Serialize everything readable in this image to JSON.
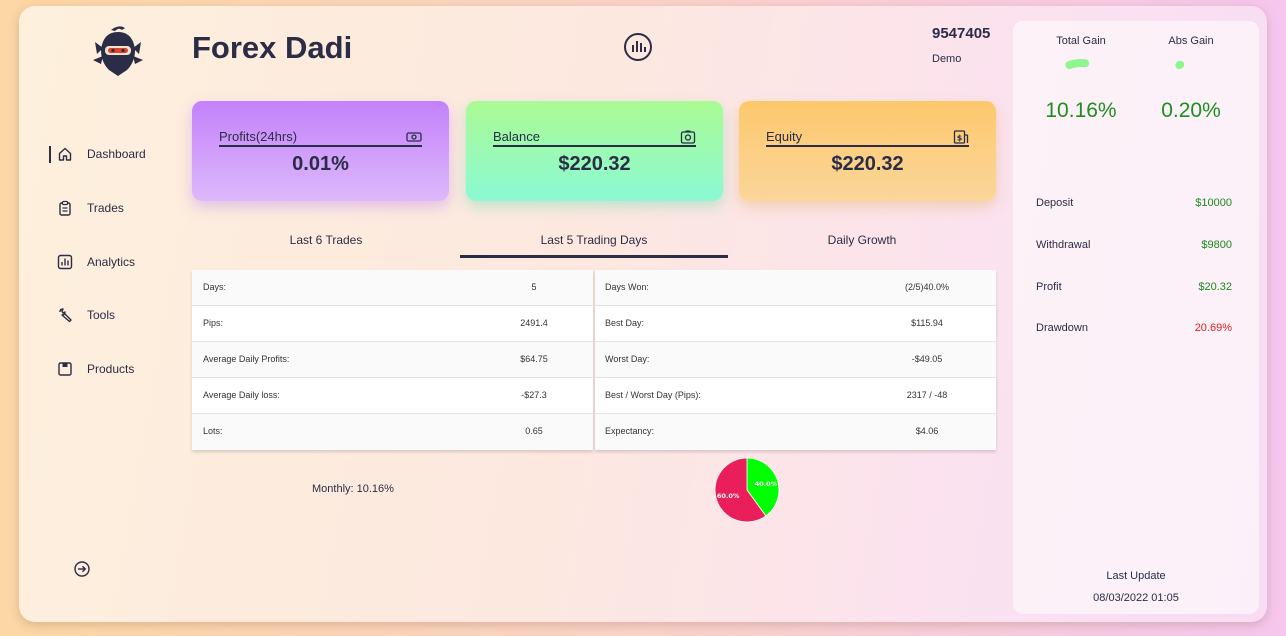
{
  "app": {
    "title": "Forex Dadi",
    "account_number": "9547405",
    "account_type": "Demo"
  },
  "sidebar": {
    "items": [
      {
        "label": "Dashboard",
        "icon": "home-icon",
        "active": true
      },
      {
        "label": "Trades",
        "icon": "clipboard-icon",
        "active": false
      },
      {
        "label": "Analytics",
        "icon": "bar-chart-icon",
        "active": false
      },
      {
        "label": "Tools",
        "icon": "tools-icon",
        "active": false
      },
      {
        "label": "Products",
        "icon": "box-icon",
        "active": false
      }
    ],
    "logout_icon": "logout-icon"
  },
  "cards": [
    {
      "label": "Profits(24hrs)",
      "value": "0.01%",
      "icon": "cash-icon"
    },
    {
      "label": "Balance",
      "value": "$220.32",
      "icon": "safe-icon"
    },
    {
      "label": "Equity",
      "value": "$220.32",
      "icon": "equity-icon"
    }
  ],
  "tabs": [
    {
      "label": "Last 6 Trades",
      "active": false
    },
    {
      "label": "Last 5 Trading Days",
      "active": true
    },
    {
      "label": "Daily Growth",
      "active": false
    }
  ],
  "table_left": [
    {
      "k": "Days:",
      "v": "5"
    },
    {
      "k": "Pips:",
      "v": "2491.4"
    },
    {
      "k": "Average Daily Profits:",
      "v": "$64.75"
    },
    {
      "k": "Average Daily loss:",
      "v": "-$27.3"
    },
    {
      "k": "Lots:",
      "v": "0.65"
    }
  ],
  "table_right": [
    {
      "k": "Days Won:",
      "v": "(2/5)40.0%"
    },
    {
      "k": "Best Day:",
      "v": "$115.94"
    },
    {
      "k": "Worst Day:",
      "v": "-$49.05"
    },
    {
      "k": "Best / Worst Day (Pips):",
      "v": "2317 / -48"
    },
    {
      "k": "Expectancy:",
      "v": "$4.06"
    }
  ],
  "monthly": "Monthly: 10.16%",
  "chart_data": {
    "type": "pie",
    "slices": [
      {
        "label": "40.0%",
        "value": 40.0,
        "color": "#00ff00"
      },
      {
        "label": "60.0%",
        "value": 60.0,
        "color": "#e91e5a"
      }
    ]
  },
  "panel": {
    "total_gain_label": "Total Gain",
    "total_gain_value": "10.16%",
    "total_gain_level": 10.16,
    "abs_gain_label": "Abs Gain",
    "abs_gain_value": "0.20%",
    "abs_gain_level": 0.2,
    "stats": [
      {
        "k": "Deposit",
        "v": "$10000",
        "tone": "pos"
      },
      {
        "k": "Withdrawal",
        "v": "$9800",
        "tone": "pos"
      },
      {
        "k": "Profit",
        "v": "$20.32",
        "tone": "pos"
      },
      {
        "k": "Drawdown",
        "v": "20.69%",
        "tone": "neg"
      }
    ],
    "last_update_label": "Last Update",
    "last_update_value": "08/03/2022 01:05"
  },
  "colors": {
    "text_dark": "#2a2d45",
    "gain_green": "#1e8f1e",
    "negative_red": "#e0201e",
    "gauge_green": "#8ff58f"
  }
}
